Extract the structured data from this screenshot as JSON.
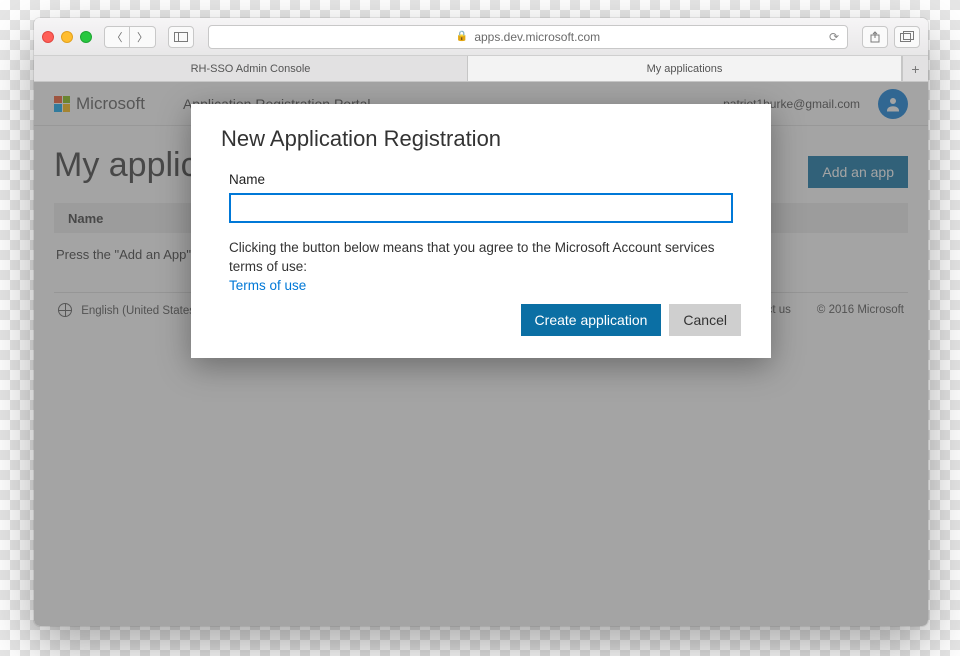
{
  "browser": {
    "url_display": "apps.dev.microsoft.com",
    "tabs": [
      "RH-SSO Admin Console",
      "My applications"
    ],
    "active_tab_index": 1
  },
  "header": {
    "brand": "Microsoft",
    "portal_title": "Application Registration Portal",
    "user_email": "patriot1burke@gmail.com"
  },
  "page": {
    "title": "My applications",
    "add_button": "Add an app",
    "table_header": "Name",
    "empty_hint": "Press the \"Add an App\" button to begin."
  },
  "footer": {
    "language": "English (United States)",
    "contact": "Contact us",
    "copyright": "© 2016 Microsoft"
  },
  "dialog": {
    "title": "New Application Registration",
    "name_label": "Name",
    "name_value": "",
    "terms_text": "Clicking the button below means that you agree to the Microsoft Account services terms of use:",
    "terms_link": "Terms of use",
    "create": "Create application",
    "cancel": "Cancel"
  }
}
